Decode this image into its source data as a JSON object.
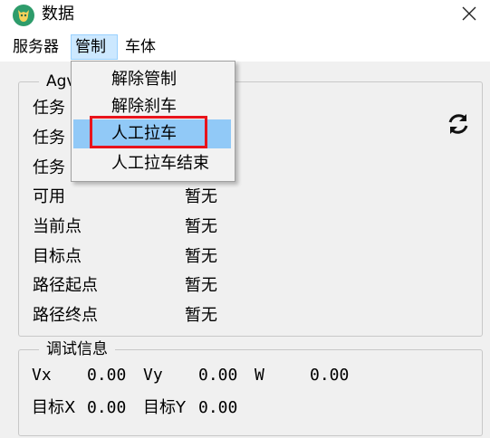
{
  "window": {
    "title": "数据",
    "icon": "app-badge-icon",
    "close_icon": "close-icon"
  },
  "menubar": {
    "items": [
      {
        "label": "服务器"
      },
      {
        "label": "管制",
        "active": true
      },
      {
        "label": "车体"
      }
    ]
  },
  "dropdown": {
    "items": [
      {
        "label": "解除管制"
      },
      {
        "label": "解除刹车"
      },
      {
        "label": "人工拉车",
        "highlighted": true
      },
      {
        "label": "人工拉车结束"
      }
    ]
  },
  "agv_group": {
    "title": "Agv",
    "refresh_icon": "refresh-icon",
    "rows": [
      {
        "label": "任务",
        "value": ""
      },
      {
        "label": "任务",
        "value": ""
      },
      {
        "label": "任务",
        "value": ""
      },
      {
        "label": "可用",
        "value": "暂无"
      },
      {
        "label": "当前点",
        "value": "暂无"
      },
      {
        "label": "目标点",
        "value": "暂无"
      },
      {
        "label": "路径起点",
        "value": "暂无"
      },
      {
        "label": "路径终点",
        "value": "暂无"
      }
    ]
  },
  "debug_group": {
    "title": "调试信息",
    "vx_label": "Vx",
    "vx_value": "0.00",
    "vy_label": "Vy",
    "vy_value": "0.00",
    "w_label": "W",
    "w_value": "0.00",
    "target_x_label": "目标X",
    "target_x_value": "0.00",
    "target_y_label": "目标Y",
    "target_y_value": "0.00"
  },
  "colors": {
    "menu_active_bg": "#cce8ff",
    "dropdown_highlight": "#91c9f7",
    "annotation_red": "#e8141c",
    "app_icon_green": "#2e9c6b"
  }
}
